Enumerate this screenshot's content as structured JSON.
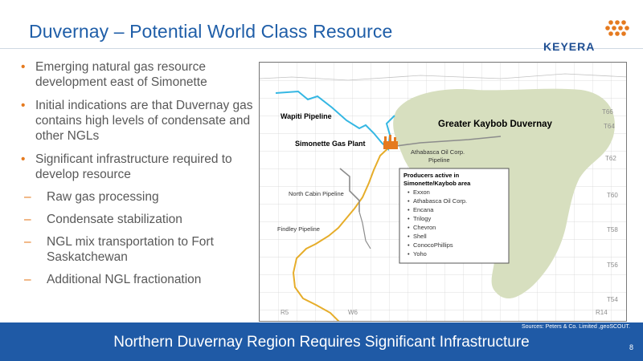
{
  "title": "Duvernay  – Potential World Class Resource",
  "logo": {
    "text": "KEYERA",
    "color": "#e57a1f"
  },
  "bullets": [
    {
      "level": 1,
      "text": "Emerging natural gas resource development east of Simonette"
    },
    {
      "level": 1,
      "text": "Initial indications are that Duvernay gas contains high levels of condensate and other NGLs"
    },
    {
      "level": 1,
      "text": "Significant infrastructure required to develop resource"
    },
    {
      "level": 2,
      "text": "Raw gas processing"
    },
    {
      "level": 2,
      "text": "Condensate stabilization"
    },
    {
      "level": 2,
      "text": "NGL mix transportation to Fort Saskatchewan"
    },
    {
      "level": 2,
      "text": "Additional NGL fractionation"
    }
  ],
  "map": {
    "region_label": "Greater Kaybob Duvernay",
    "labels": {
      "wapiti": "Wapiti Pipeline",
      "simonette": "Simonette Gas Plant",
      "athabasca": "Athabasca Oil Corp.",
      "athabasca2": "Pipeline",
      "north_cabin": "North Cabin Pipeline",
      "findley": "Findley Pipeline"
    },
    "townships": [
      "T66",
      "T64",
      "T62",
      "T60",
      "T58",
      "T56",
      "T54"
    ],
    "ranges": [
      "R5",
      "W6",
      "R14"
    ],
    "producers": {
      "title1": "Producers active in",
      "title2": "Simonette/Kaybob area",
      "items": [
        "Exxon",
        "Athabasca Oil Corp.",
        "Encana",
        "Trilogy",
        "Chevron",
        "Shell",
        "ConocoPhillips",
        "Yoho"
      ]
    },
    "colors": {
      "region": "#d7dfbf",
      "wapiti": "#35b7e3",
      "findley": "#e6ad2a",
      "plant": "#e57a1f",
      "other": "#8c8c8c"
    }
  },
  "footer": {
    "text": "Northern Duvernay Region Requires Significant Infrastructure",
    "sources": "Sources: Peters & Co. Limited ,geoSCOUT.",
    "page": "8"
  }
}
